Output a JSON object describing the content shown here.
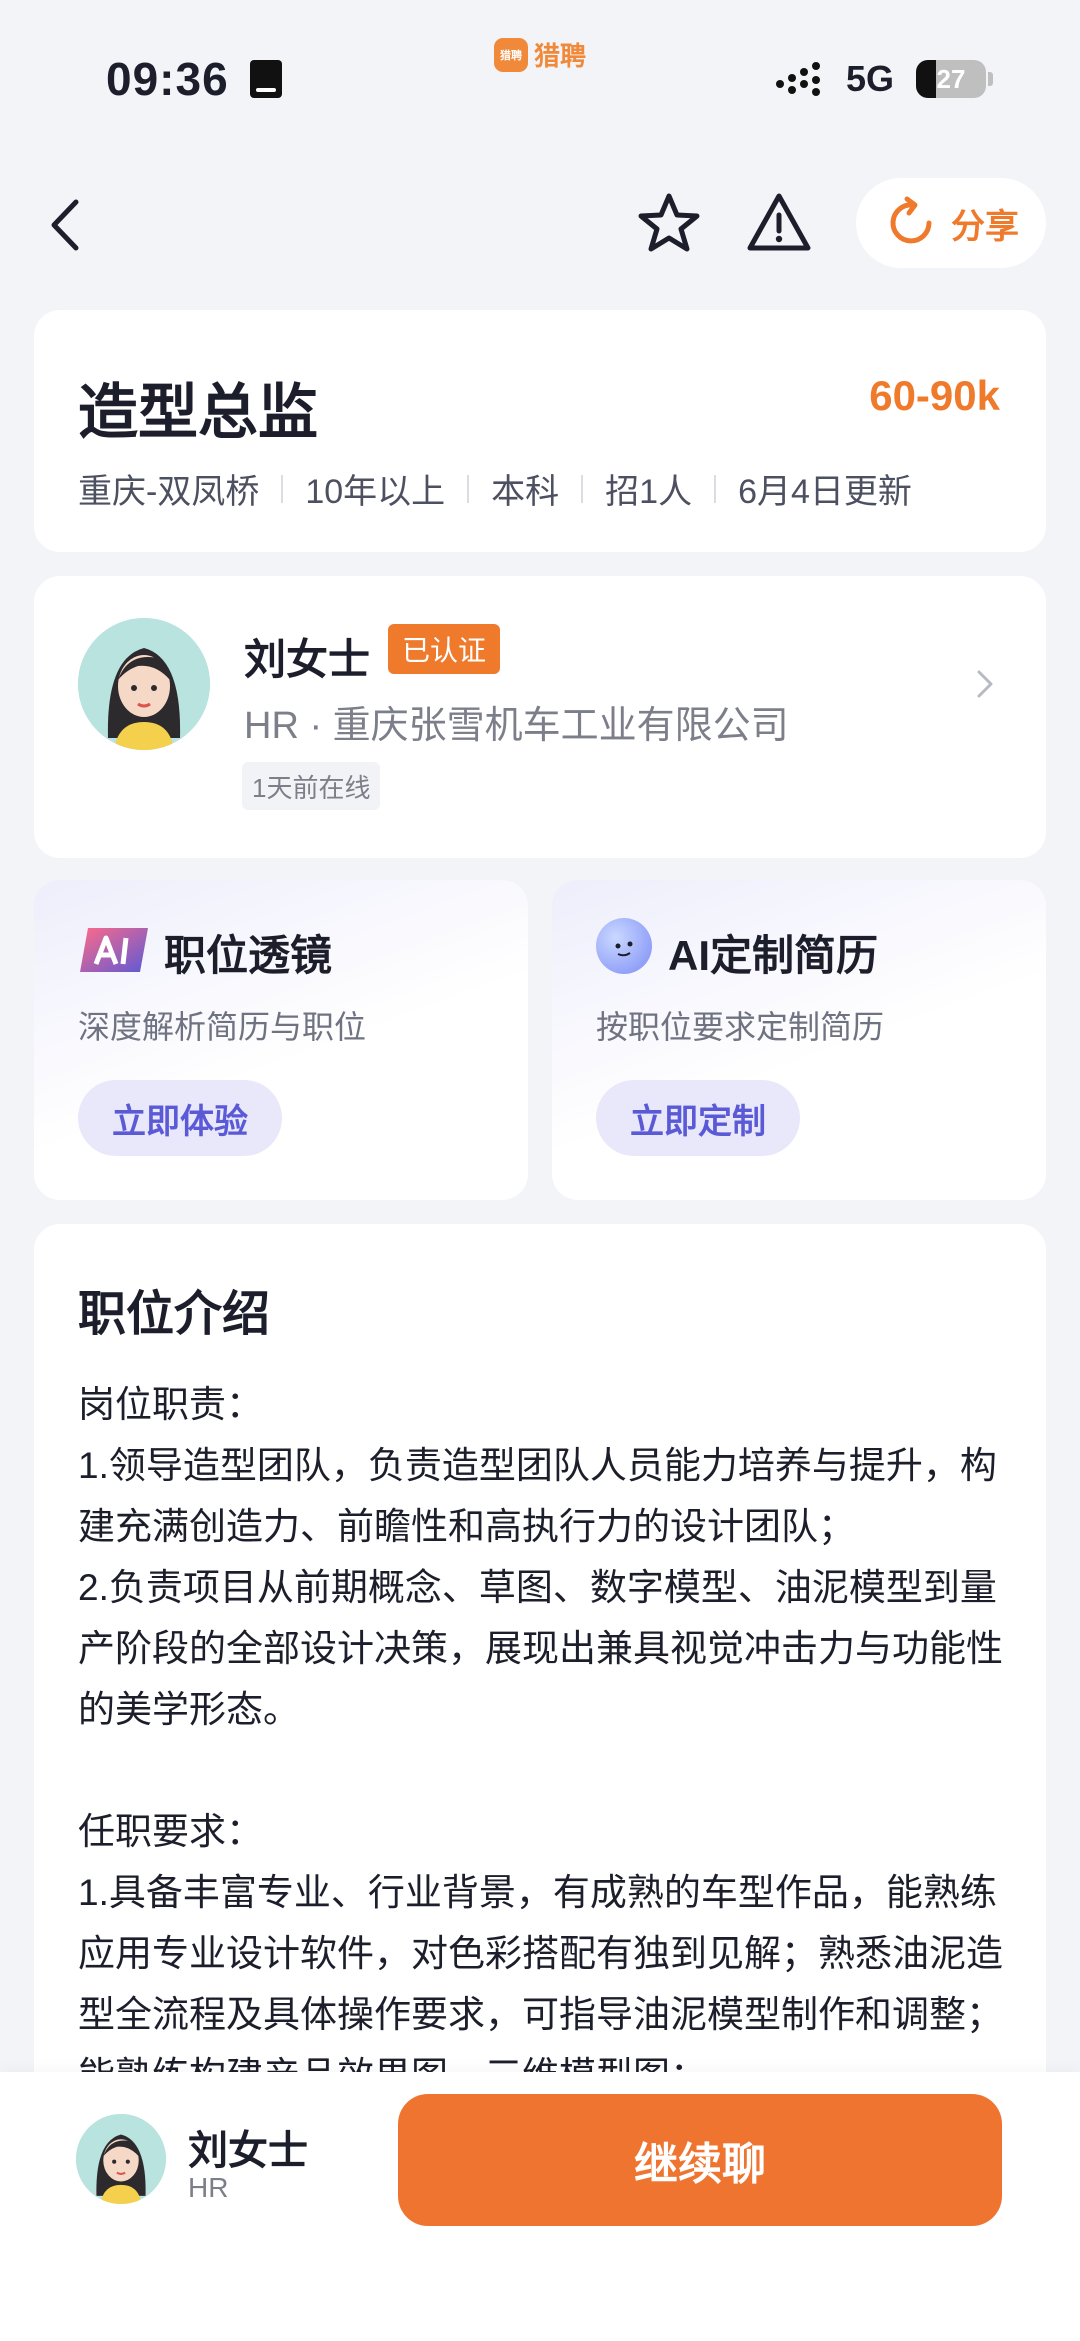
{
  "status_bar": {
    "time": "09:36",
    "app_name": "猎聘",
    "app_logo_text": "猎聘",
    "network": "5G",
    "battery": "27"
  },
  "nav": {
    "share_label": "分享"
  },
  "job": {
    "title": "造型总监",
    "salary": "60-90k",
    "meta": [
      "重庆-双凤桥",
      "10年以上",
      "本科",
      "招1人",
      "6月4日更新"
    ]
  },
  "recruiter": {
    "name": "刘女士",
    "verified_label": "已认证",
    "company_line": "HR · 重庆张雪机车工业有限公司",
    "online_status": "1天前在线",
    "role": "HR"
  },
  "promos": [
    {
      "title": "职位透镜",
      "desc": "深度解析简历与职位",
      "button": "立即体验"
    },
    {
      "title": "AI定制简历",
      "desc": "按职位要求定制简历",
      "button": "立即定制"
    }
  ],
  "description": {
    "title": "职位介绍",
    "body": "岗位职责：\n1.领导造型团队，负责造型团队人员能力培养与提升，构建充满创造力、前瞻性和高执行力的设计团队；\n2.负责项目从前期概念、草图、数字模型、油泥模型到量产阶段的全部设计决策，展现出兼具视觉冲击力与功能性的美学形态。\n\n任职要求：\n1.具备丰富专业、行业背景，有成熟的车型作品，能熟练应用专业设计软件，对色彩搭配有独到见解；熟悉油泥造型全流程及具体操作要求，可指导油泥模型制作和调整；能熟练构建产品效果图、三维模型图；"
  },
  "bottom_bar": {
    "chat_button": "继续聊"
  },
  "colors": {
    "accent": "#f07a2c",
    "promo_button_text": "#5b5ad6",
    "background": "#f3f4f8"
  }
}
